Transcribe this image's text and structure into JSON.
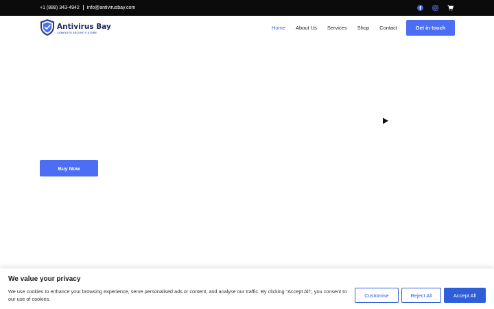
{
  "topbar": {
    "phone": "+1 (888) 343-4942",
    "email": "info@antivirusbay.com",
    "icons": [
      "facebook-icon",
      "instagram-icon",
      "cart-icon"
    ]
  },
  "header": {
    "logo_name": "Antivirus Bay",
    "logo_tagline": "COMPLETE SECURITY STORE",
    "nav": [
      {
        "label": "Home",
        "active": true
      },
      {
        "label": "About Us",
        "active": false
      },
      {
        "label": "Services",
        "active": false
      },
      {
        "label": "Shop",
        "active": false
      },
      {
        "label": "Contact",
        "active": false
      }
    ],
    "cta_label": "Get in touch"
  },
  "hero": {
    "buy_label": "Buy Now"
  },
  "cookie": {
    "title": "We value your privacy",
    "text": "We use cookies to enhance your browsing experience, serve personalised ads or content, and analyse our traffic. By clicking \"Accept All\", you consent to our use of cookies.",
    "customise": "Customise",
    "reject": "Reject All",
    "accept": "Accept All"
  },
  "colors": {
    "accent": "#4c6ef5",
    "cookie_accent": "#2f5fd8",
    "brand_dark": "#1f2a5e",
    "topbar_bg": "#0b0b0b"
  }
}
